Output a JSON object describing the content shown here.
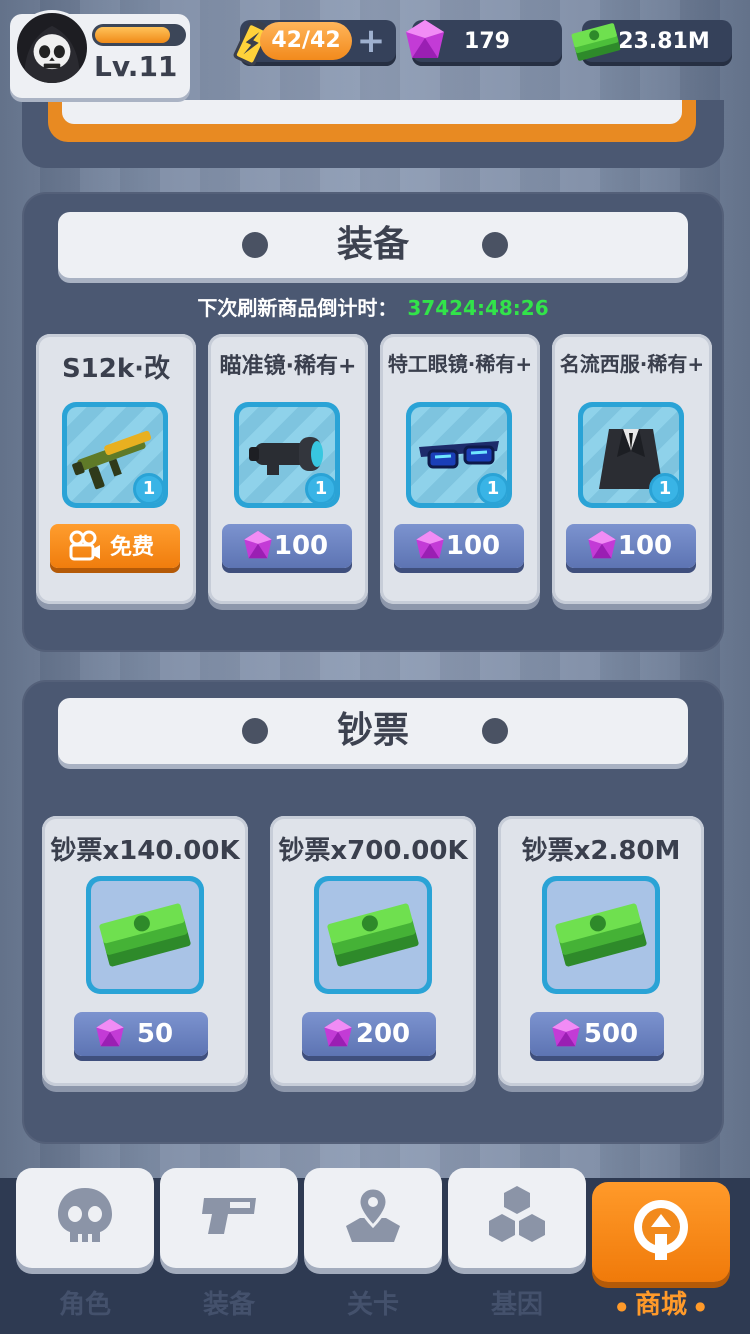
{
  "player": {
    "level": "Lv.11",
    "exp_fraction": 0.85
  },
  "resources": {
    "energy": "42/42",
    "gems": "179",
    "cash": "23.81M"
  },
  "equip_section": {
    "title": "装备",
    "refresh_label": "下次刷新商品倒计时：",
    "refresh_timer": "37424:48:26",
    "items": [
      {
        "name": "S12k·改",
        "qty": "1",
        "price": "免费",
        "icon": "gun-icon"
      },
      {
        "name": "瞄准镜·稀有+",
        "qty": "1",
        "price": "100",
        "icon": "scope-icon"
      },
      {
        "name": "特工眼镜·稀有+",
        "qty": "1",
        "price": "100",
        "icon": "glasses-icon"
      },
      {
        "name": "名流西服·稀有+",
        "qty": "1",
        "price": "100",
        "icon": "suit-icon"
      }
    ]
  },
  "cash_section": {
    "title": "钞票",
    "items": [
      {
        "name": "钞票x140.00K",
        "price": "50"
      },
      {
        "name": "钞票x700.00K",
        "price": "200"
      },
      {
        "name": "钞票x2.80M",
        "price": "500"
      }
    ]
  },
  "nav": {
    "tabs": [
      {
        "label": "角色",
        "icon": "skull-icon"
      },
      {
        "label": "装备",
        "icon": "weapon-icon"
      },
      {
        "label": "关卡",
        "icon": "map-pin-icon"
      },
      {
        "label": "基因",
        "icon": "hexagons-icon"
      },
      {
        "label": "商城",
        "icon": "shop-icon",
        "active": true
      }
    ]
  },
  "colors": {
    "accent": "#f28a1c",
    "panel": "#4b5872",
    "timer": "#32e34a",
    "price_button": "#6f86c4"
  }
}
